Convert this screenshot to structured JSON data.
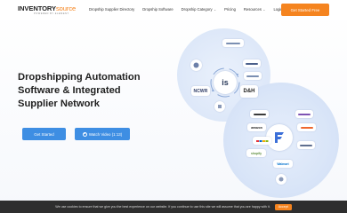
{
  "header": {
    "logo_main": "INVENTORY",
    "logo_accent": "source",
    "logo_sub": "POWERED BY ELEMENT",
    "nav": [
      {
        "label": "Dropship Supplier Directory",
        "dropdown": false
      },
      {
        "label": "Dropship Software",
        "dropdown": false
      },
      {
        "label": "Dropship Category",
        "dropdown": true
      },
      {
        "label": "Pricing",
        "dropdown": false
      },
      {
        "label": "Resources",
        "dropdown": true
      },
      {
        "label": "Login",
        "dropdown": false
      }
    ],
    "cta_label": "Get Started Free"
  },
  "hero": {
    "title_line1": "Dropshipping Automation",
    "title_line2": "Software & Integrated",
    "title_line3": "Supplier Network",
    "primary_button": "Get Started",
    "secondary_button": "Watch Video (1:13)"
  },
  "illustration": {
    "hub_top": "is",
    "chips": {
      "dh": "D&H",
      "ncwr": "NCWR",
      "amazon": "amazon",
      "shopify": "shopify",
      "walmart": "Walmart"
    }
  },
  "cookie": {
    "text": "We use cookies to ensure that we give you the best experience on our website. If you continue to use this site we will assume that you are happy with it.",
    "button": "Accept"
  },
  "colors": {
    "brand_orange": "#f5841f",
    "button_blue": "#3e8ee3",
    "cookie_bg": "#2e2e2e"
  }
}
